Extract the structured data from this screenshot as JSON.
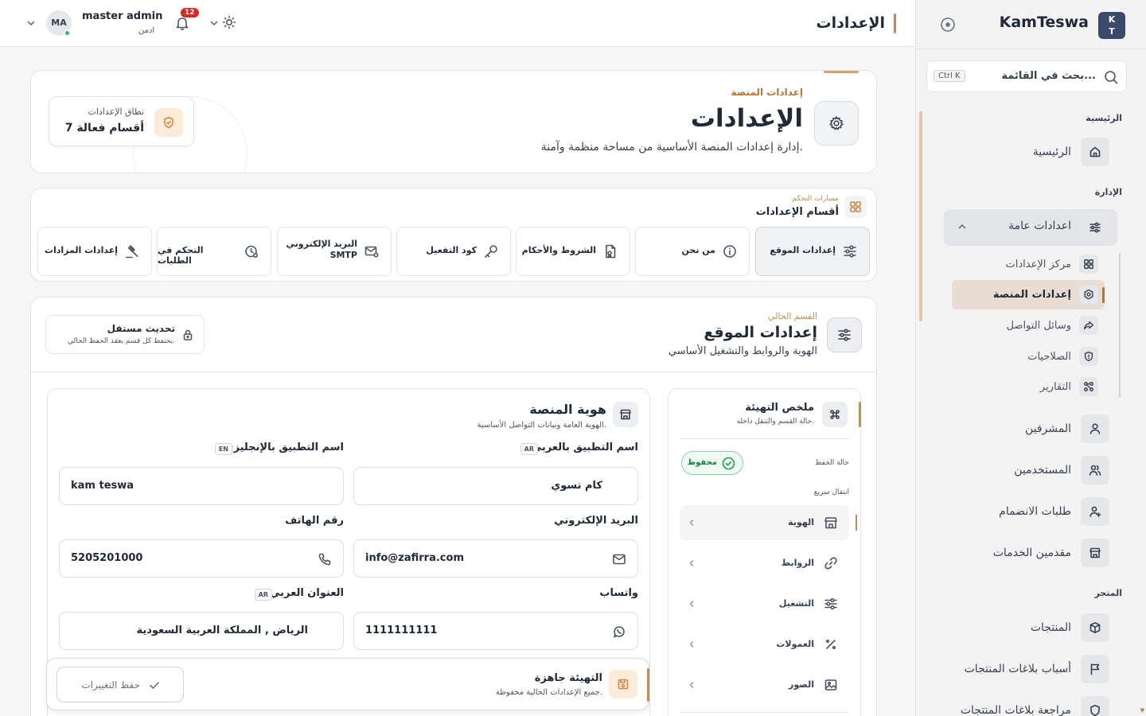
{
  "header": {
    "page_title": "الإعدادات",
    "user_initials": "MA",
    "user_name": "master admin",
    "user_role": "ادمن",
    "notifications_count": "12"
  },
  "sidebar": {
    "logo_text": "K\nT",
    "brand": "KamTeswa",
    "search_placeholder": "بحث في القائمة...",
    "search_shortcut": "Ctrl K",
    "groups": {
      "home": "الرئيسية",
      "management": "الإدارة",
      "store": "المتجر"
    },
    "items": {
      "home": "الرئيسية",
      "general_settings": "اعدادات عامة",
      "settings_center": "مركز الإعدادات",
      "platform_settings": "إعدادات المنصة",
      "social_media": "وسائل التواصل",
      "permissions": "الصلاحيات",
      "reports": "التقارير",
      "supervisors": "المشرفين",
      "users": "المستخدمين",
      "join_requests": "طلبات الانضمام",
      "service_providers": "مقدمين الخدمات",
      "products": "المنتجات",
      "product_report_reasons": "أسباب بلاغات المنتجات",
      "product_report_review": "مراجعة بلاغات المنتجات"
    }
  },
  "hero": {
    "eyebrow": "إعدادات المنصة",
    "title": "الإعدادات",
    "subtitle": "إدارة إعدادات المنصة الأساسية من مساحة منظمة وآمنة.",
    "scope_label": "نطاق الإعدادات",
    "scope_value": "7 أقسام فعالة"
  },
  "tabs": {
    "eyebrow": "مسارات التحكم",
    "title": "أقسام الإعدادات",
    "items": [
      {
        "label": "إعدادات الموقع"
      },
      {
        "label": "من نحن"
      },
      {
        "label": "الشروط والأحكام"
      },
      {
        "label": "كود التفعيل"
      },
      {
        "label": "البريد الإلكتروني",
        "label2": "SMTP"
      },
      {
        "label": "التحكم في الطلبات"
      },
      {
        "label": "إعدادات المزادات"
      }
    ]
  },
  "section": {
    "eyebrow": "القسم الحالي",
    "title": "إعدادات الموقع",
    "subtitle": "الهوية والروابط والتشغيل الأساسي",
    "independent_title": "تحديث مستقل",
    "independent_sub": "يحتفظ كل قسم بعقد الحفظ الحالي."
  },
  "summary": {
    "title": "ملخص التهيئة",
    "subtitle": "حالة القسم والتنقل داخله.",
    "save_state_label": "حالة الحفظ",
    "save_state_value": "محفوظ",
    "quick_nav_label": "انتقال سريع",
    "nav": [
      "الهوية",
      "الروابط",
      "التشغيل",
      "العمولات",
      "الصور"
    ]
  },
  "identity": {
    "title": "هوية المنصة",
    "subtitle": "الهوية العامة وبيانات التواصل الأساسية.",
    "fields": {
      "app_name_ar": {
        "label": "اسم التطبيق بالعربي",
        "lang": "AR",
        "value": "كام تسوي"
      },
      "app_name_en": {
        "label": "اسم التطبيق بالإنجليزي",
        "lang": "EN",
        "value": "kam teswa"
      },
      "email": {
        "label": "البريد الإلكتروني",
        "value": "info@zafirra.com"
      },
      "phone": {
        "label": "رقم الهاتف",
        "value": "5205201000"
      },
      "whatsapp": {
        "label": "واتساب",
        "value": "1111111111"
      },
      "address_ar": {
        "label": "العنوان العربي",
        "lang": "AR",
        "value": "الرياض , المملكة العربية السعودية"
      }
    }
  },
  "savebar": {
    "title": "التهيئة جاهزة",
    "subtitle": "جميع الإعدادات الحالية محفوظة.",
    "button": "حفظ التغييرات"
  },
  "colors": {
    "accent": "#c98a52",
    "brand_logo": "#3b4a6b",
    "success": "#16a34a",
    "badge": "#dc2626"
  }
}
